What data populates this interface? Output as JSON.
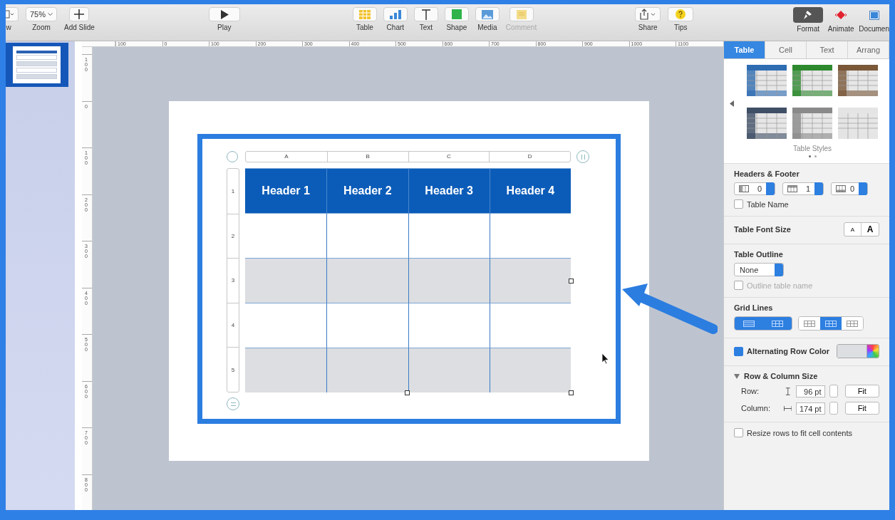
{
  "toolbar": {
    "left": [
      {
        "kind": "view",
        "label": "w"
      },
      {
        "kind": "zoom",
        "label": "Zoom",
        "value": "75%"
      },
      {
        "kind": "add",
        "label": "Add Slide"
      }
    ],
    "play": {
      "label": "Play"
    },
    "insert": [
      {
        "kind": "table",
        "label": "Table",
        "disabled": false
      },
      {
        "kind": "chart",
        "label": "Chart",
        "disabled": false
      },
      {
        "kind": "text",
        "label": "Text",
        "disabled": false
      },
      {
        "kind": "shape",
        "label": "Shape",
        "disabled": false
      },
      {
        "kind": "media",
        "label": "Media",
        "disabled": false
      },
      {
        "kind": "comment",
        "label": "Comment",
        "disabled": true
      }
    ],
    "share": [
      {
        "kind": "share",
        "label": "Share"
      },
      {
        "kind": "tips",
        "label": "Tips"
      }
    ],
    "right": [
      {
        "kind": "format",
        "label": "Format",
        "selected": true
      },
      {
        "kind": "animate",
        "label": "Animate",
        "selected": false
      },
      {
        "kind": "document",
        "label": "Documen",
        "selected": false
      }
    ]
  },
  "slide_navigator": {
    "slides": [
      {
        "selected": true
      }
    ]
  },
  "horizontal_ruler": [
    "100",
    "0",
    "100",
    "200",
    "300",
    "400",
    "500",
    "600",
    "700",
    "800",
    "900",
    "1000",
    "1100"
  ],
  "vertical_ruler": [
    "100",
    "0",
    "100",
    "200",
    "300",
    "400",
    "500",
    "600",
    "700",
    "800"
  ],
  "table": {
    "columns": [
      "A",
      "B",
      "C",
      "D"
    ],
    "rows": [
      {
        "number": "1",
        "kind": "header",
        "cells": [
          "Header 1",
          "Header 2",
          "Header 3",
          "Header 4"
        ]
      },
      {
        "number": "2",
        "kind": "body"
      },
      {
        "number": "3",
        "kind": "body"
      },
      {
        "number": "4",
        "kind": "body"
      },
      {
        "number": "5",
        "kind": "body"
      }
    ]
  },
  "inspector": {
    "tabs": [
      {
        "label": "Table",
        "selected": true
      },
      {
        "label": "Cell",
        "selected": false
      },
      {
        "label": "Text",
        "selected": false
      },
      {
        "label": "Arrang",
        "selected": false
      }
    ],
    "table_styles": {
      "label": "Table Styles",
      "styles": [
        {
          "color": "#2f6db3"
        },
        {
          "color": "#2f8a2f"
        },
        {
          "color": "#7a5838"
        },
        {
          "color": "#3f4f66"
        },
        {
          "color": "#8a8a8a"
        },
        {
          "color": "#e4e4e4"
        }
      ],
      "pages": [
        {
          "selected": true
        },
        {
          "selected": false
        }
      ]
    },
    "headers_footer": {
      "title": "Headers & Footer",
      "steppers": [
        {
          "kind": "header-columns",
          "value": "0"
        },
        {
          "kind": "header-rows",
          "value": "1"
        },
        {
          "kind": "footer-rows",
          "value": "0"
        }
      ],
      "table_name": {
        "label": "Table Name",
        "checked": false
      }
    },
    "font_size": {
      "label": "Table Font Size",
      "buttons": [
        "A",
        "A"
      ]
    },
    "outline": {
      "title": "Table Outline",
      "value": "None",
      "outline_name": {
        "label": "Outline table name",
        "checked": false,
        "disabled": true
      }
    },
    "grid_lines": {
      "title": "Grid Lines",
      "groups": [
        {
          "buttons": [
            {
              "kind": "horizontal",
              "selected": true
            },
            {
              "kind": "vertical",
              "selected": true
            }
          ]
        },
        {
          "buttons": [
            {
              "kind": "header-column",
              "selected": false
            },
            {
              "kind": "header-row",
              "selected": true
            },
            {
              "kind": "footer",
              "selected": false
            }
          ]
        }
      ]
    },
    "alternating_rows": {
      "label": "Alternating Row Color",
      "checked": true
    },
    "size": {
      "title": "Row & Column Size",
      "expanded": true,
      "fields": [
        {
          "kind": "row",
          "label": "Row:",
          "value": "96 pt",
          "button": "Fit"
        },
        {
          "kind": "column",
          "label": "Column:",
          "value": "174 pt",
          "button": "Fit"
        }
      ]
    },
    "resize": {
      "label": "Resize rows to fit cell contents",
      "checked": false
    }
  }
}
